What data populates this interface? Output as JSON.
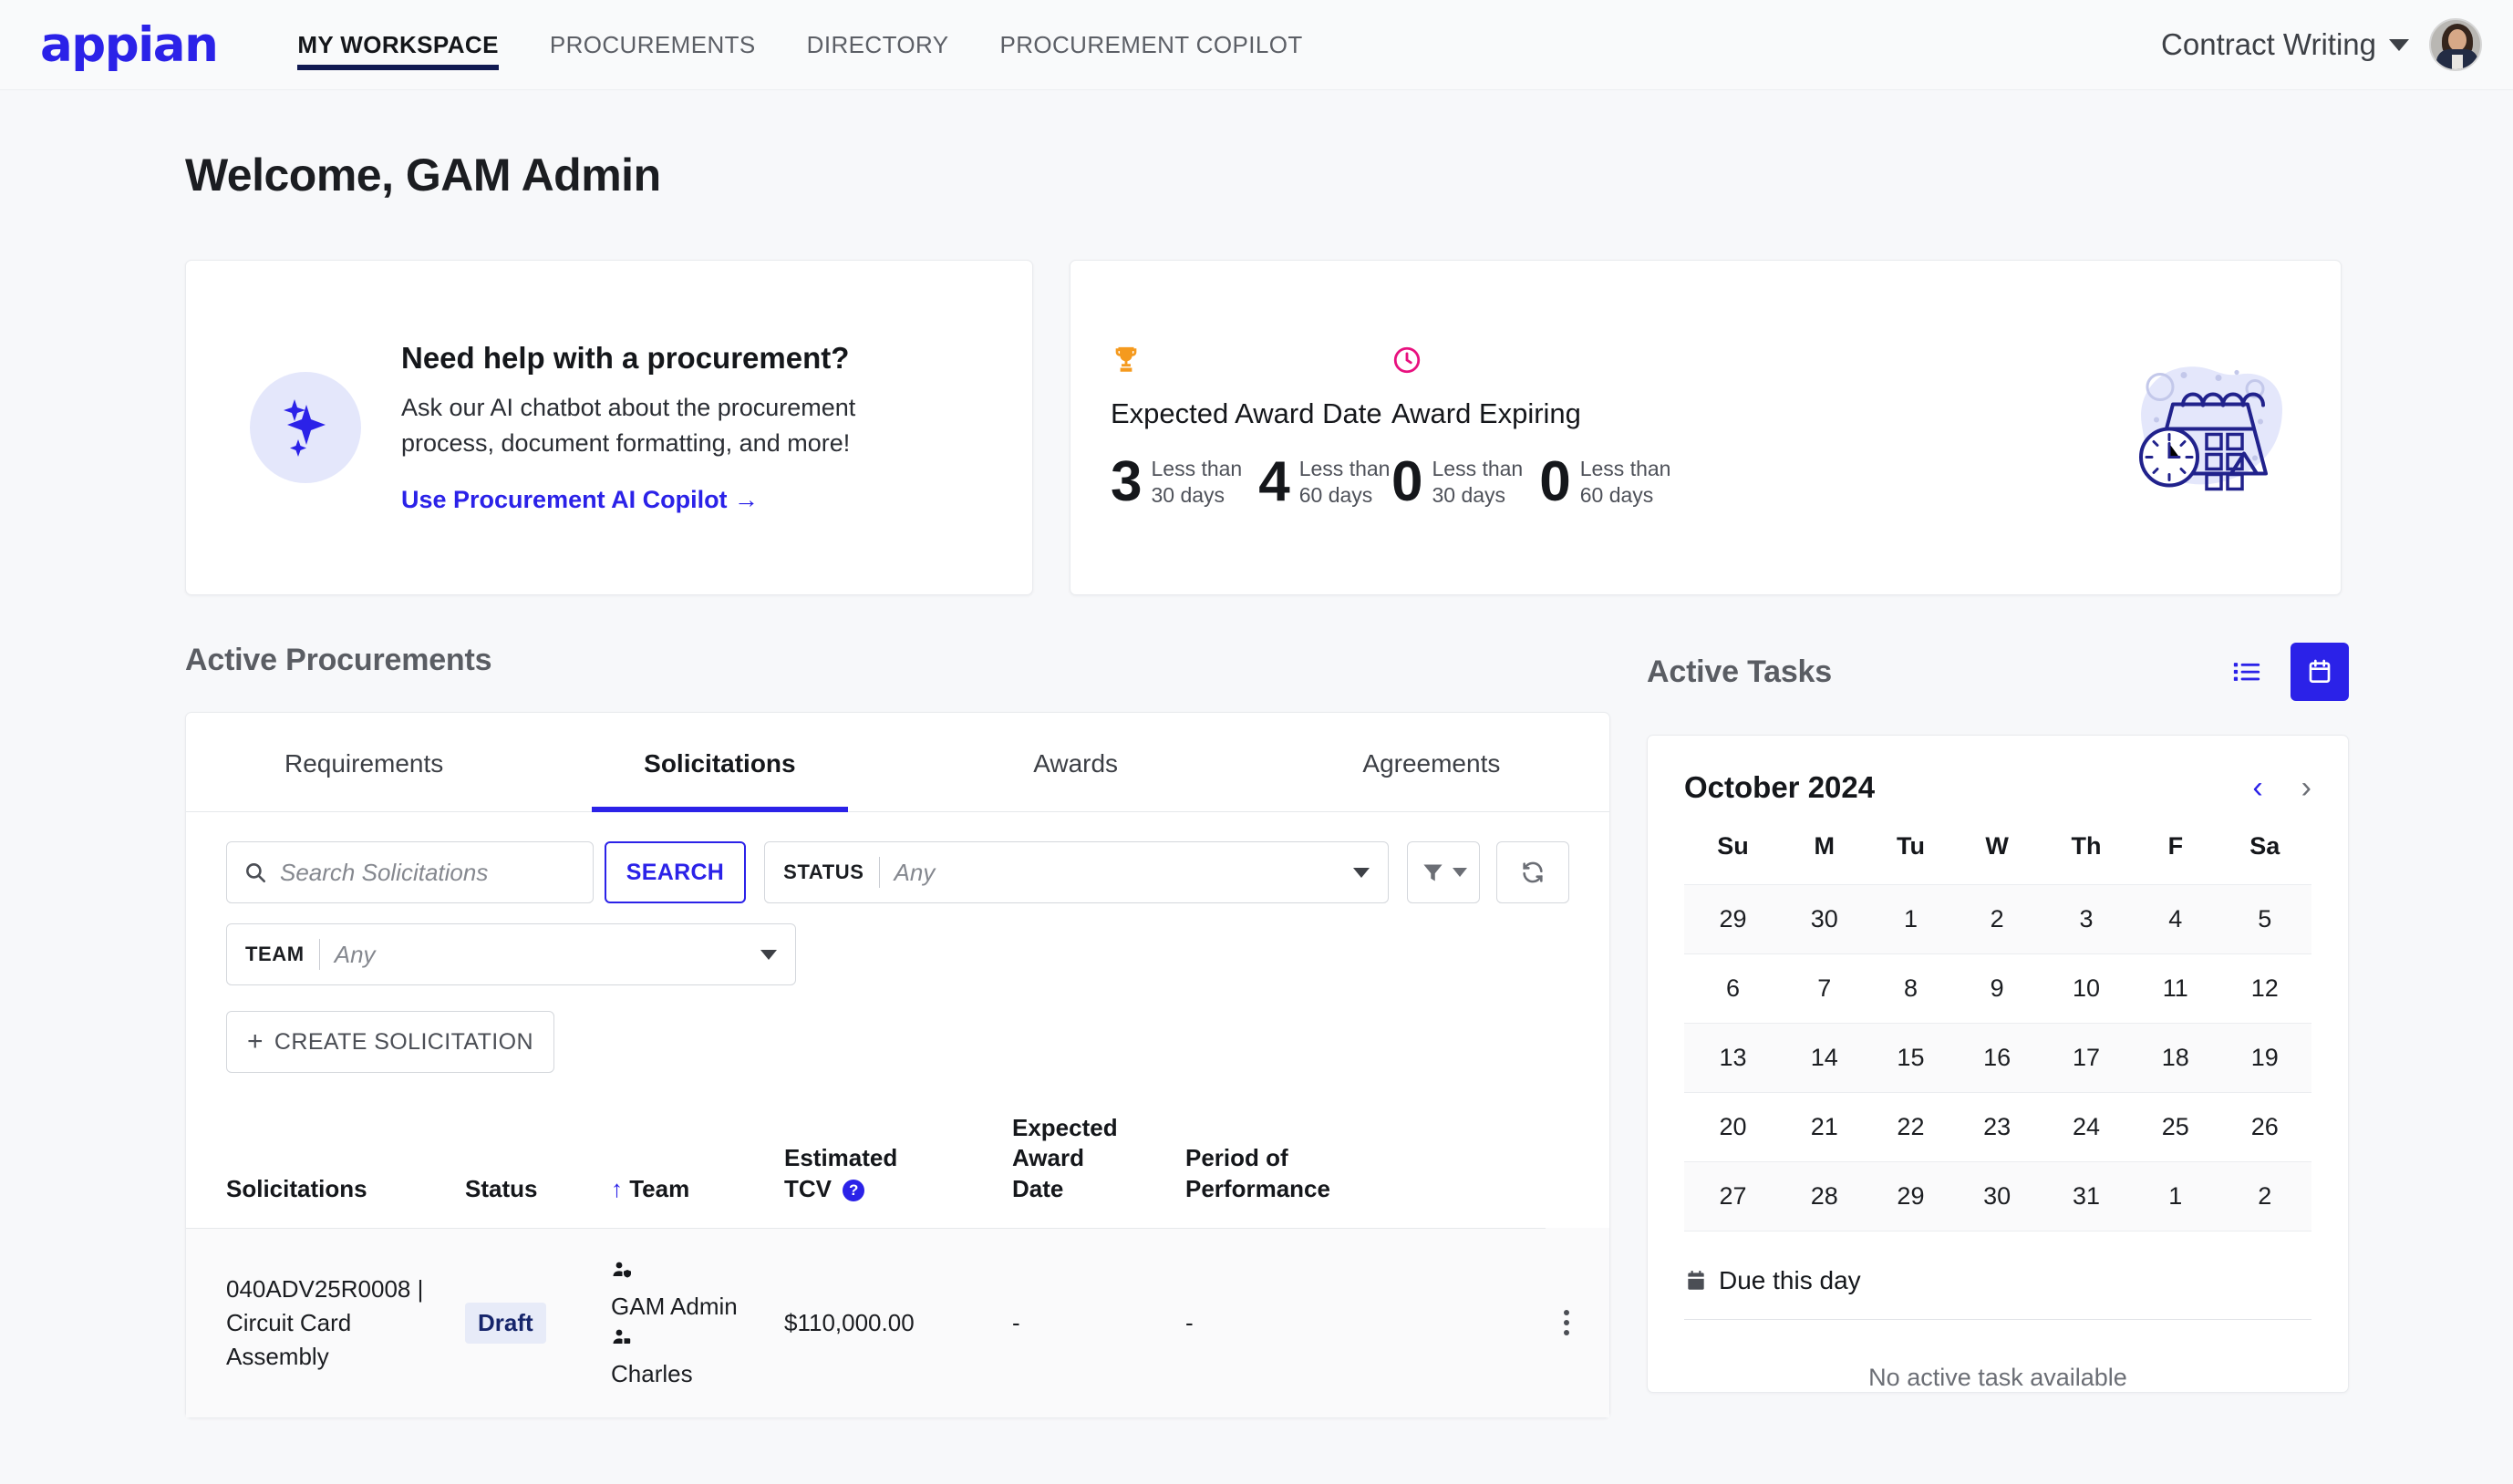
{
  "nav": {
    "logo": "appian",
    "items": [
      {
        "label": "MY WORKSPACE",
        "active": true
      },
      {
        "label": "PROCUREMENTS",
        "active": false
      },
      {
        "label": "DIRECTORY",
        "active": false
      },
      {
        "label": "PROCUREMENT COPILOT",
        "active": false
      }
    ],
    "user_menu_label": "Contract Writing"
  },
  "page": {
    "welcome": "Welcome, GAM Admin"
  },
  "help_card": {
    "title": "Need help with a procurement?",
    "description": "Ask our AI chatbot about the procurement process, document formatting, and more!",
    "link": "Use Procurement AI Copilot →"
  },
  "kpi_card": {
    "blocks": [
      {
        "icon": "trophy-icon",
        "title": "Expected Award Date",
        "metrics": [
          {
            "value": "3",
            "label_line1": "Less than",
            "label_line2": "30 days"
          },
          {
            "value": "4",
            "label_line1": "Less than",
            "label_line2": "60 days"
          }
        ]
      },
      {
        "icon": "clock-icon",
        "title": "Award Expiring",
        "metrics": [
          {
            "value": "0",
            "label_line1": "Less than",
            "label_line2": "30 days"
          },
          {
            "value": "0",
            "label_line1": "Less than",
            "label_line2": "60 days"
          }
        ]
      }
    ]
  },
  "procurements": {
    "section_title": "Active Procurements",
    "tabs": [
      {
        "label": "Requirements",
        "active": false
      },
      {
        "label": "Solicitations",
        "active": true
      },
      {
        "label": "Awards",
        "active": false
      },
      {
        "label": "Agreements",
        "active": false
      }
    ],
    "search": {
      "placeholder": "Search Solicitations",
      "value": "",
      "button": "SEARCH"
    },
    "status_filter": {
      "label": "STATUS",
      "value": "Any"
    },
    "team_filter": {
      "label": "TEAM",
      "value": "Any"
    },
    "create_button": "CREATE SOLICITATION",
    "columns": [
      "Solicitations",
      "Status",
      "Team",
      "Estimated TCV",
      "Expected Award Date",
      "Period of Performance"
    ],
    "sort_column": "Team",
    "sort_direction": "ascending",
    "rows": [
      {
        "solicitation": "040ADV25R0008 | Circuit Card Assembly",
        "status": "Draft",
        "team": [
          "GAM Admin",
          "Charles"
        ],
        "estimated_tcv": "$110,000.00",
        "expected_award_date": "-",
        "period_of_performance": "-"
      }
    ]
  },
  "tasks": {
    "section_title": "Active Tasks",
    "view_list_icon": "list-view-icon",
    "view_calendar_icon": "calendar-view-icon",
    "active_view": "calendar",
    "calendar": {
      "month_label": "October 2024",
      "weekdays": [
        "Su",
        "M",
        "Tu",
        "W",
        "Th",
        "F",
        "Sa"
      ],
      "weeks": [
        [
          {
            "day": "29",
            "muted": true
          },
          {
            "day": "30",
            "muted": true
          },
          {
            "day": "1",
            "today": true
          },
          {
            "day": "2"
          },
          {
            "day": "3"
          },
          {
            "day": "4"
          },
          {
            "day": "5"
          }
        ],
        [
          {
            "day": "6"
          },
          {
            "day": "7"
          },
          {
            "day": "8"
          },
          {
            "day": "9"
          },
          {
            "day": "10"
          },
          {
            "day": "11"
          },
          {
            "day": "12"
          }
        ],
        [
          {
            "day": "13"
          },
          {
            "day": "14"
          },
          {
            "day": "15"
          },
          {
            "day": "16"
          },
          {
            "day": "17"
          },
          {
            "day": "18"
          },
          {
            "day": "19"
          }
        ],
        [
          {
            "day": "20"
          },
          {
            "day": "21"
          },
          {
            "day": "22"
          },
          {
            "day": "23"
          },
          {
            "day": "24"
          },
          {
            "day": "25"
          },
          {
            "day": "26"
          }
        ],
        [
          {
            "day": "27"
          },
          {
            "day": "28"
          },
          {
            "day": "29"
          },
          {
            "day": "30"
          },
          {
            "day": "31"
          },
          {
            "day": "1",
            "muted": true
          },
          {
            "day": "2",
            "muted": true
          }
        ]
      ]
    },
    "due_this_day_label": "Due this day",
    "empty_message": "No active task available"
  },
  "colors": {
    "accent_blue": "#2b22e8",
    "nav_underline": "#111a52",
    "trophy_orange": "#f59a1e",
    "clock_pink": "#e8117f",
    "badge_bg": "#e7ebf8",
    "badge_text": "#16256b",
    "page_bg": "#f7f8fa"
  }
}
